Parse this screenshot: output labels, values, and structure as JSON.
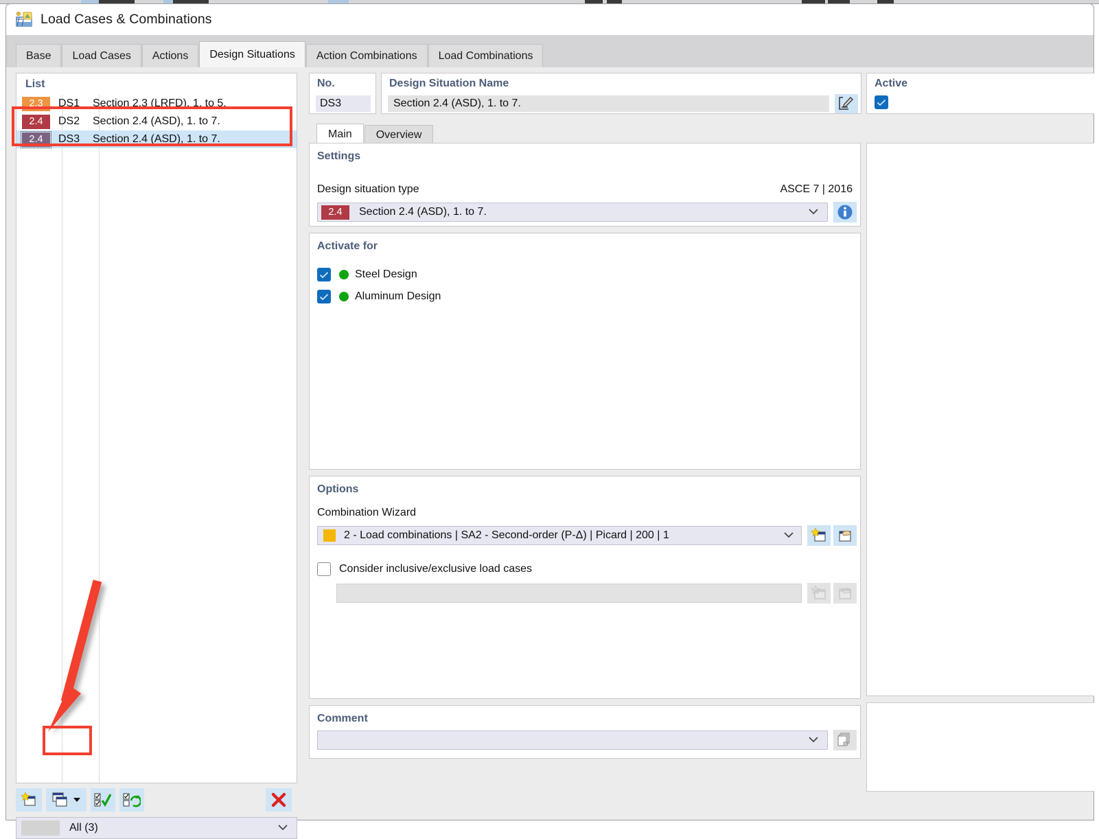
{
  "window": {
    "title": "Load Cases & Combinations",
    "icon": "load-cases-combinations-icon"
  },
  "tabs": [
    {
      "label": "Base",
      "active": false
    },
    {
      "label": "Load Cases",
      "active": false
    },
    {
      "label": "Actions",
      "active": false
    },
    {
      "label": "Design Situations",
      "active": true
    },
    {
      "label": "Action Combinations",
      "active": false
    },
    {
      "label": "Load Combinations",
      "active": false
    }
  ],
  "list_panel": {
    "header": "List",
    "rows": [
      {
        "badge": "2.3",
        "badge_color": "#ED9442",
        "code": "DS1",
        "description": "Section 2.3 (LRFD), 1. to 5.",
        "selected": false,
        "focused": false
      },
      {
        "badge": "2.4",
        "badge_color": "#B03A45",
        "code": "DS2",
        "description": "Section 2.4 (ASD), 1. to 7.",
        "selected": false,
        "focused": false
      },
      {
        "badge": "2.4",
        "badge_color": "#7C6280",
        "code": "DS3",
        "description": "Section 2.4 (ASD), 1. to 7.",
        "selected": true,
        "focused": true
      }
    ],
    "toolbar": [
      {
        "name": "new-design-situation-button",
        "icon": "new-window-star-icon"
      },
      {
        "name": "copy-design-situation-button",
        "icon": "copy-windows-icon",
        "has_dropdown": true
      },
      {
        "name": "select-all-button",
        "icon": "checkbox-check-icon"
      },
      {
        "name": "invert-selection-button",
        "icon": "checkbox-refresh-icon"
      },
      {
        "name": "delete-button",
        "icon": "red-x-icon"
      }
    ],
    "filter": {
      "label": "All (3)",
      "caret": "chevron-down-icon"
    }
  },
  "header": {
    "no_label": "No.",
    "no_value": "DS3",
    "name_label": "Design Situation Name",
    "name_value": "Section 2.4 (ASD), 1. to 7.",
    "name_edit_icon": "edit-pencil-icon",
    "active_label": "Active",
    "active_checked": true
  },
  "inner_tabs": [
    {
      "label": "Main",
      "active": true
    },
    {
      "label": "Overview",
      "active": false
    }
  ],
  "settings": {
    "title": "Settings",
    "type_label": "Design situation type",
    "standard": "ASCE 7 | 2016",
    "type_badge": "2.4",
    "type_badge_color": "#B03A45",
    "type_value": "Section 2.4 (ASD), 1. to 7.",
    "caret": "chevron-down-icon",
    "info_icon": "info-circle-icon"
  },
  "activate_for": {
    "title": "Activate for",
    "items": [
      {
        "label": "Steel Design",
        "checked": true,
        "dot_color": "#11A411"
      },
      {
        "label": "Aluminum Design",
        "checked": true,
        "dot_color": "#11A411"
      }
    ]
  },
  "options": {
    "title": "Options",
    "wizard_label": "Combination Wizard",
    "wizard_swatch_color": "#F5B800",
    "wizard_value": "2 - Load combinations | SA2 - Second-order (P-Δ) | Picard | 200 | 1",
    "wizard_caret": "chevron-down-icon",
    "wizard_new_icon": "new-window-star-icon",
    "wizard_edit_icon": "edit-window-hand-icon",
    "inclusive_label": "Consider inclusive/exclusive load cases",
    "inclusive_checked": false,
    "inclusive_new_icon": "new-window-star-icon-disabled",
    "inclusive_edit_icon": "edit-window-hand-icon-disabled"
  },
  "comment": {
    "title": "Comment",
    "value": "",
    "caret": "chevron-down-icon",
    "copy_icon": "copy-pages-icon"
  },
  "annotations": {
    "highlight_color": "#F3402F",
    "arrow_color": "#F3402F",
    "highlight_list_rows": "DS2 and DS3 rows",
    "highlight_button": "copy-design-situation-button"
  }
}
